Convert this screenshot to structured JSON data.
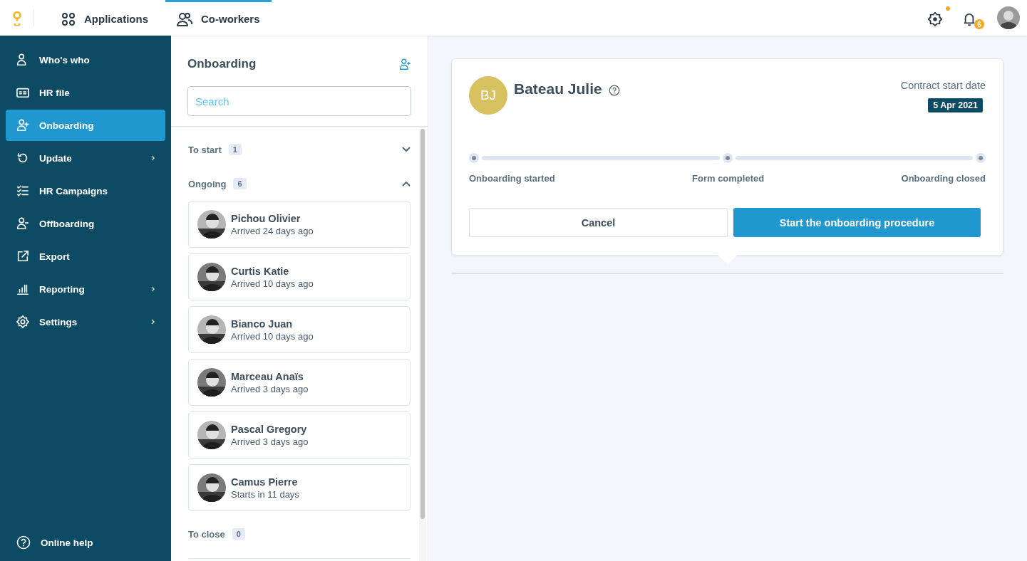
{
  "topbar": {
    "tabs": [
      {
        "label": "Applications",
        "selected": false
      },
      {
        "label": "Co-workers",
        "selected": true
      }
    ],
    "notifications": "6"
  },
  "sidebar": {
    "items": [
      {
        "label": "Who's who",
        "selected": false,
        "submenu": false
      },
      {
        "label": "HR file",
        "selected": false,
        "submenu": false
      },
      {
        "label": "Onboarding",
        "selected": true,
        "submenu": false
      },
      {
        "label": "Update",
        "selected": false,
        "submenu": true
      },
      {
        "label": "HR Campaigns",
        "selected": false,
        "submenu": false
      },
      {
        "label": "Offboarding",
        "selected": false,
        "submenu": false
      },
      {
        "label": "Export",
        "selected": false,
        "submenu": false
      },
      {
        "label": "Reporting",
        "selected": false,
        "submenu": true
      },
      {
        "label": "Settings",
        "selected": false,
        "submenu": true
      }
    ],
    "help": "Online help"
  },
  "list": {
    "title": "Onboarding",
    "search": {
      "placeholder": "Search"
    },
    "sections": [
      {
        "label": "To start",
        "count": "1",
        "expanded": false
      },
      {
        "label": "Ongoing",
        "count": "6",
        "expanded": true,
        "people": [
          {
            "name": "Pichou Olivier",
            "status": "Arrived 24 days ago"
          },
          {
            "name": "Curtis Katie",
            "status": "Arrived 10 days ago"
          },
          {
            "name": "Bianco Juan",
            "status": "Arrived 10 days ago"
          },
          {
            "name": "Marceau Anaïs",
            "status": "Arrived 3 days ago"
          },
          {
            "name": "Pascal Gregory",
            "status": "Arrived 3 days ago"
          },
          {
            "name": "Camus Pierre",
            "status": "Starts in 11 days"
          }
        ]
      },
      {
        "label": "To close",
        "count": "0"
      }
    ]
  },
  "detail": {
    "initials": "BJ",
    "name": "Bateau Julie",
    "date_label": "Contract start date",
    "date": "5 Apr 2021",
    "steps": [
      "Onboarding started",
      "Form completed",
      "Onboarding closed"
    ],
    "buttons": [
      "Cancel",
      "Start the onboarding procedure"
    ]
  }
}
